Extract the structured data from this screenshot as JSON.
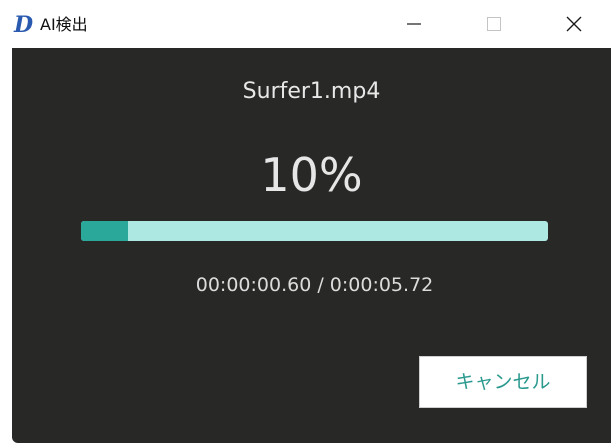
{
  "window": {
    "title": "AI検出",
    "app_icon_glyph": "D",
    "controls": [
      "minimize",
      "maximize",
      "close"
    ]
  },
  "progress": {
    "filename": "Surfer1.mp4",
    "percent_text": "10%",
    "fraction": 0.1,
    "time_text": "00:00:00.60 / 0:00:05.72"
  },
  "actions": {
    "cancel_label": "キャンセル"
  },
  "colors": {
    "background": "#282826",
    "progress_fill": "#2aa89a",
    "progress_track": "#aee8e2",
    "accent_text": "#2a9a8e"
  }
}
